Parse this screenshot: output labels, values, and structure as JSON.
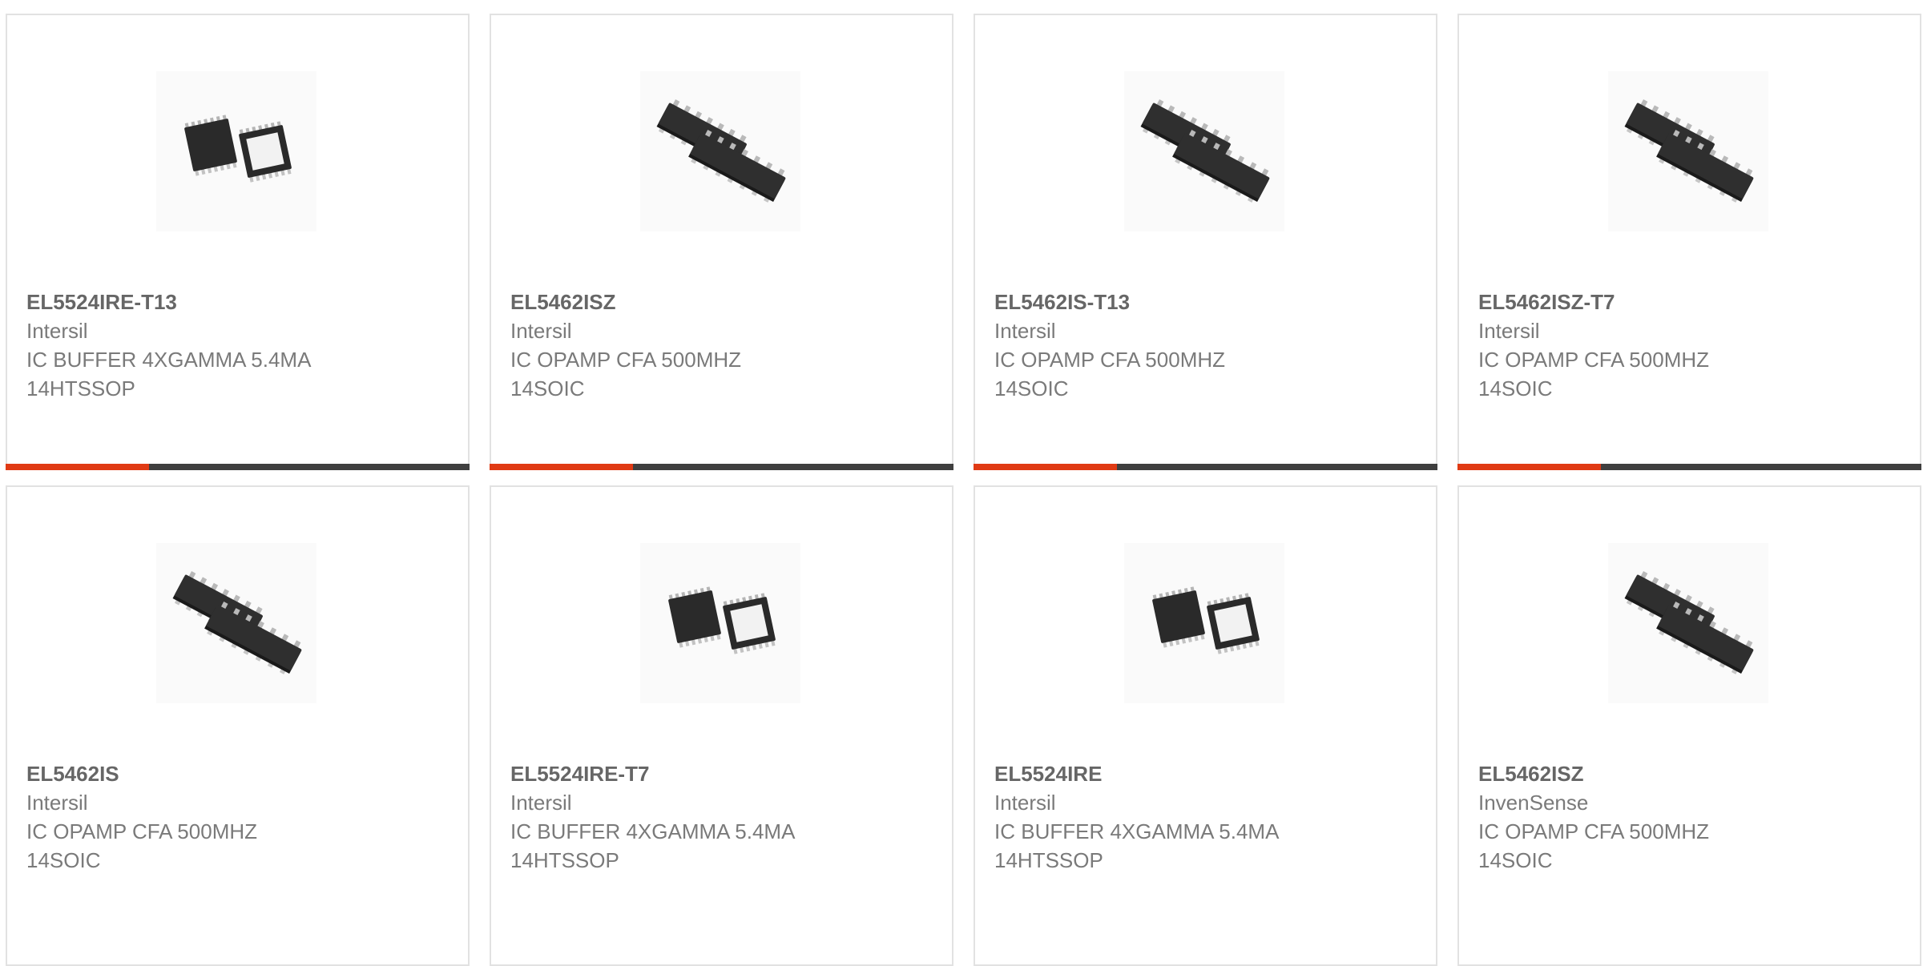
{
  "colors": {
    "accent": "#e03a14",
    "bar_dark": "#3f3f3f",
    "card_border": "#e2e2e2",
    "part_text": "#666666",
    "body_text": "#7a7a7a"
  },
  "products": [
    {
      "part": "EL5524IRE-T13",
      "manufacturer": "Intersil",
      "desc_line1": "IC BUFFER 4XGAMMA 5.4MA",
      "desc_line2": "14HTSSOP",
      "image": "htssop-package-image",
      "progress": 0.31
    },
    {
      "part": "EL5462ISZ",
      "manufacturer": "Intersil",
      "desc_line1": "IC OPAMP CFA 500MHZ",
      "desc_line2": "14SOIC",
      "image": "soic-package-image",
      "progress": 0.31
    },
    {
      "part": "EL5462IS-T13",
      "manufacturer": "Intersil",
      "desc_line1": "IC OPAMP CFA 500MHZ",
      "desc_line2": "14SOIC",
      "image": "soic-package-image",
      "progress": 0.31
    },
    {
      "part": "EL5462ISZ-T7",
      "manufacturer": "Intersil",
      "desc_line1": "IC OPAMP CFA 500MHZ",
      "desc_line2": "14SOIC",
      "image": "soic-package-image",
      "progress": 0.31
    },
    {
      "part": "EL5462IS",
      "manufacturer": "Intersil",
      "desc_line1": "IC OPAMP CFA 500MHZ",
      "desc_line2": "14SOIC",
      "image": "soic-package-image"
    },
    {
      "part": "EL5524IRE-T7",
      "manufacturer": "Intersil",
      "desc_line1": "IC BUFFER 4XGAMMA 5.4MA",
      "desc_line2": "14HTSSOP",
      "image": "htssop-package-image"
    },
    {
      "part": "EL5524IRE",
      "manufacturer": "Intersil",
      "desc_line1": "IC BUFFER 4XGAMMA 5.4MA",
      "desc_line2": "14HTSSOP",
      "image": "htssop-package-image"
    },
    {
      "part": "EL5462ISZ",
      "manufacturer": "InvenSense",
      "desc_line1": "IC OPAMP CFA 500MHZ",
      "desc_line2": "14SOIC",
      "image": "soic-package-image"
    }
  ]
}
